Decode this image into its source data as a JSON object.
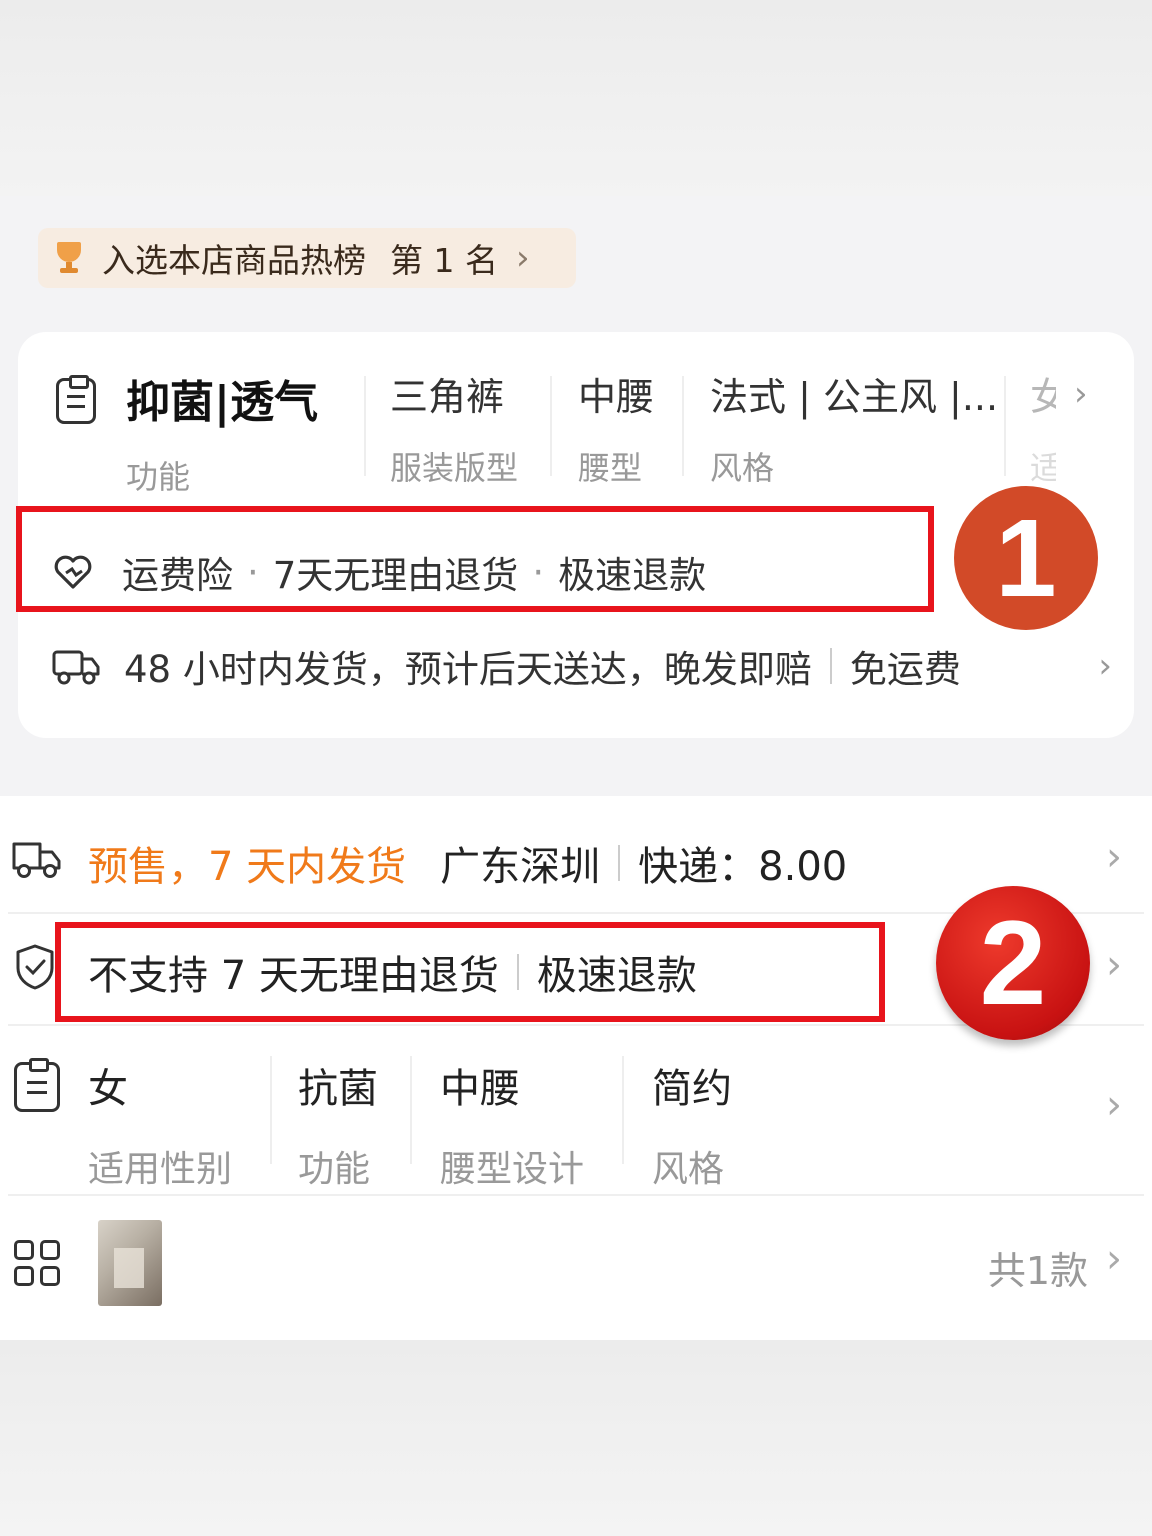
{
  "screen1": {
    "rank_badge": {
      "text": "入选本店商品热榜",
      "rank": "第 1 名",
      "chevron": "›"
    },
    "attributes": [
      {
        "value": "抑菌|透气",
        "label": "功能"
      },
      {
        "value": "三角裤",
        "label": "服装版型"
      },
      {
        "value": "中腰",
        "label": "腰型"
      },
      {
        "value": "法式 | 公主风 |...",
        "label": "风格"
      },
      {
        "value": "女",
        "label": "适"
      }
    ],
    "attr_chevron": "›",
    "services": [
      "运费险",
      "7天无理由退货",
      "极速退款"
    ],
    "service_sep": "·",
    "shipping": {
      "text": "48 小时内发货，预计后天送达，晚发即赔",
      "free": "免运费",
      "chevron": "›"
    }
  },
  "annotations": {
    "one": "1",
    "two": "2"
  },
  "screen2": {
    "delivery": {
      "presale": "预售，7 天内发货",
      "location": "广东深圳",
      "fee": "快递：8.00",
      "chevron": "›"
    },
    "guarantee": {
      "no_return": "不支持 7 天无理由退货",
      "refund": "极速退款",
      "chevron": "›"
    },
    "attributes": [
      {
        "value": "女",
        "label": "适用性别"
      },
      {
        "value": "抗菌",
        "label": "功能"
      },
      {
        "value": "中腰",
        "label": "腰型设计"
      },
      {
        "value": "简约",
        "label": "风格"
      }
    ],
    "attr_chevron": "›",
    "variants": {
      "count": "共1款",
      "chevron": "›"
    }
  },
  "colors": {
    "accent_red": "#e8141c",
    "presale_orange": "#f07a1a"
  }
}
